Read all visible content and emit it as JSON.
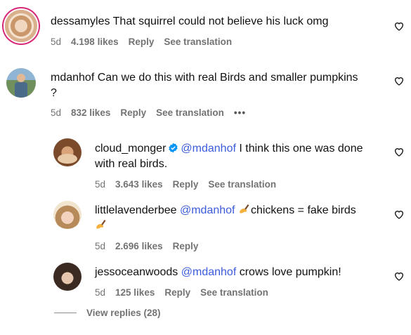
{
  "comments": [
    {
      "username": "dessamyles",
      "text": "That squirrel could not believe his luck omg",
      "time": "5d",
      "likes": "4.198 likes",
      "reply": "Reply",
      "translate": "See translation"
    },
    {
      "username": "mdanhof",
      "text": "Can we do this with real Birds and smaller pumpkins",
      "text2": "?",
      "time": "5d",
      "likes": "832 likes",
      "reply": "Reply",
      "translate": "See translation",
      "more": "•••"
    }
  ],
  "replies": [
    {
      "username": "cloud_monger",
      "mention": "@mdanhof",
      "text": "I think this one was done",
      "text2": "with real birds.",
      "time": "5d",
      "likes": "3.643 likes",
      "reply": "Reply",
      "translate": "See translation"
    },
    {
      "username": "littlelavenderbee",
      "mention": "@mdanhof",
      "text": "chickens = fake birds",
      "time": "5d",
      "likes": "2.696 likes",
      "reply": "Reply"
    },
    {
      "username": "jessoceanwoods",
      "mention": "@mdanhof",
      "text": "crows love pumpkin!",
      "time": "5d",
      "likes": "125 likes",
      "reply": "Reply",
      "translate": "See translation"
    }
  ],
  "view_replies": "View replies (28)",
  "colors": {
    "mention": "#3b5bdb",
    "meta": "#737373",
    "verified": "#0095f6"
  }
}
